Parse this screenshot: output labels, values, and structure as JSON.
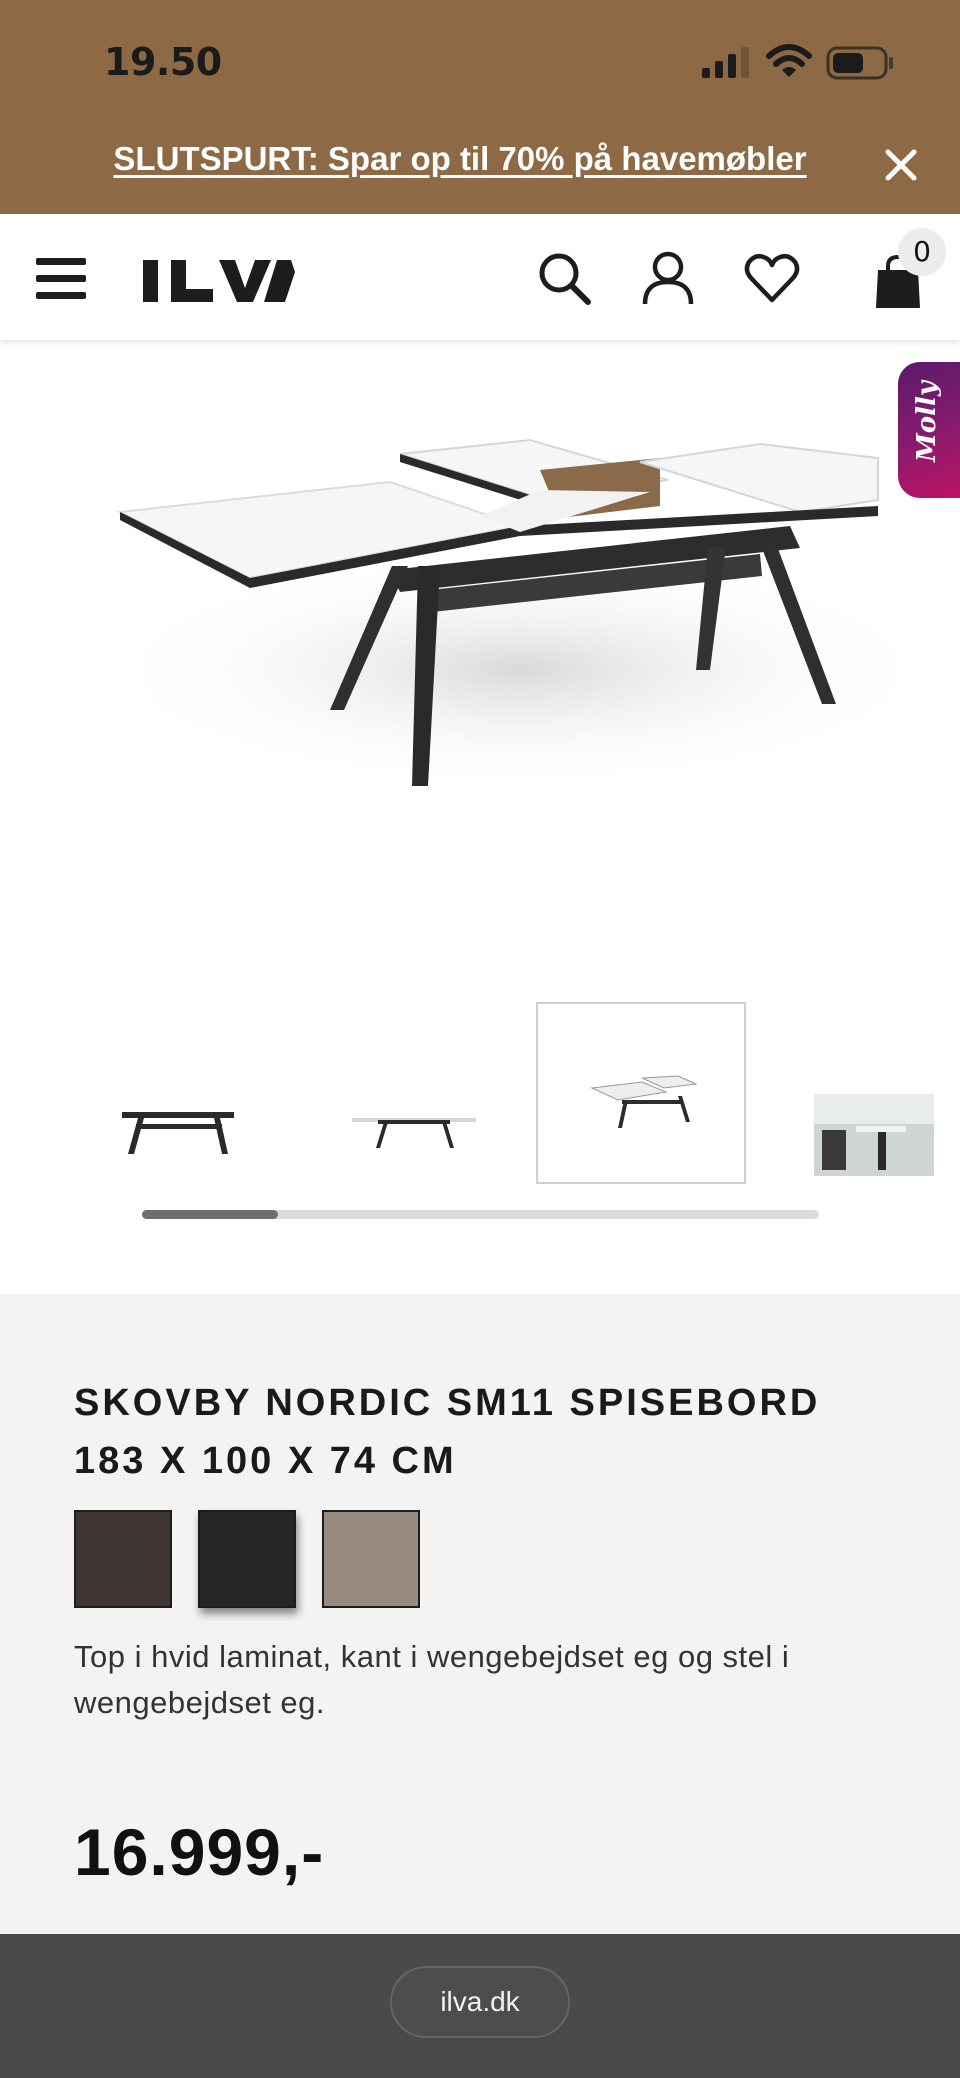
{
  "status_bar": {
    "time": "19.50",
    "signal_icon": "cellular-signal-icon",
    "wifi_icon": "wifi-icon",
    "battery_icon": "battery-icon"
  },
  "promo_banner": {
    "text": "SLUTSPURT: Spar op til 70% på havemøbler",
    "close_icon": "close-icon",
    "background": "#8d6a45"
  },
  "header": {
    "logo": "ILVA",
    "menu_icon": "hamburger-menu-icon",
    "search_icon": "search-icon",
    "account_icon": "user-icon",
    "wishlist_icon": "heart-icon",
    "cart_icon": "shopping-bag-icon",
    "cart_count": "0"
  },
  "chat_widget": {
    "label": "Molly"
  },
  "gallery": {
    "selected_index": 2,
    "thumbnail_count": 4,
    "scroll_fraction": 0.2
  },
  "product": {
    "brand": "SKOVBY NORDIC SM11",
    "name": "SPISEBORD 183 X 100 X 74 CM",
    "color_swatches": [
      {
        "color": "#3e3632",
        "selected": false
      },
      {
        "color": "#252525",
        "selected": true
      },
      {
        "color": "#968b7e",
        "selected": false
      }
    ],
    "description": "Top i hvid laminat, kant i wengebejdset eg og stel i wengebejdset eg.",
    "price": "16.999,-"
  },
  "browser_bar": {
    "url": "ilva.dk"
  }
}
